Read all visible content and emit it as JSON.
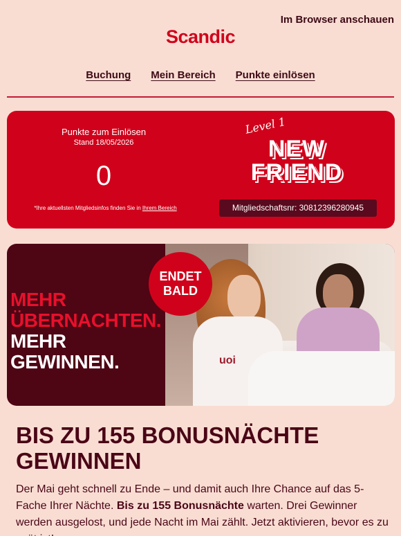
{
  "header": {
    "browser_link": "Im Browser anschauen",
    "logo": "Scandic"
  },
  "nav": {
    "items": [
      "Buchung",
      "Mein Bereich",
      "Punkte einlösen"
    ]
  },
  "points_card": {
    "label": "Punkte zum Einlösen",
    "date": "Stand 18/05/2026",
    "value": "0",
    "note_prefix": "*Ihre aktuellsten Mitgliedsinfos finden Sie in",
    "note_link": "Ihrem Bereich",
    "level_script": "Level 1",
    "level_name_line1": "NEW",
    "level_name_line2": "FRIEND",
    "member_number": "Mitgliedschaftsnr: 30812396280945"
  },
  "hero": {
    "line1": "MEHR",
    "line2": "ÜBERNACHTEN.",
    "line3": "MEHR",
    "line4": "GEWINNEN.",
    "badge_line1": "ENDET",
    "badge_line2": "BALD",
    "shirt_text": "uoi"
  },
  "article": {
    "title": "BIS ZU 155 BONUSNÄCHTE GEWINNEN",
    "body_start": "Der Mai geht schnell zu Ende – und damit auch Ihre Chance auf das 5-Fache Ihrer Nächte. ",
    "body_bold": "Bis zu 155 Bonusnächte",
    "body_end": " warten. Drei Gewinner werden ausgelost, und jede Nacht im Mai zählt. Jetzt aktivieren, bevor es zu spät ist!"
  },
  "colors": {
    "background": "#f9ddd3",
    "brand_red": "#d0021b",
    "dark_burgundy": "#3d0a16"
  }
}
